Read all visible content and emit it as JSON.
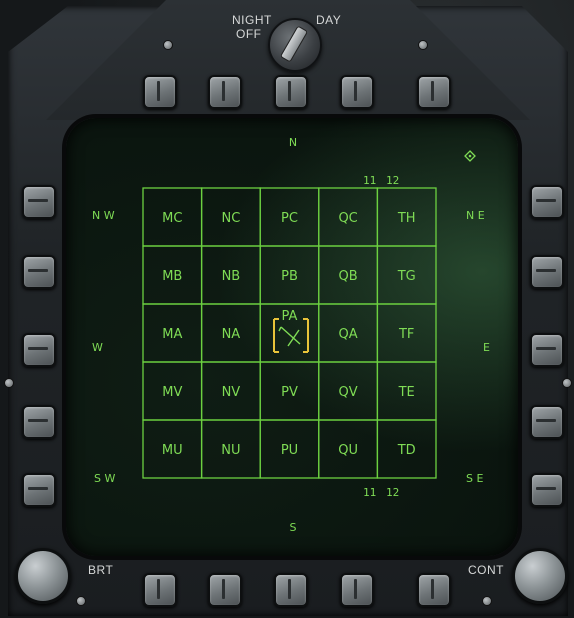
{
  "knob_labels": {
    "left": "NIGHT",
    "left2": "OFF",
    "right": "DAY"
  },
  "display": {
    "compass": {
      "n": "N",
      "s": "S",
      "w": "W",
      "e": "E",
      "nw": "N W",
      "ne": "N E",
      "sw": "S W",
      "se": "S E"
    },
    "col_numbers_top": [
      "11",
      "12"
    ],
    "col_numbers_bottom": [
      "11",
      "12"
    ],
    "grid_cells": [
      [
        "MC",
        "NC",
        "PC",
        "QC",
        "TH"
      ],
      [
        "MB",
        "NB",
        "PB",
        "QB",
        "TG"
      ],
      [
        "MA",
        "NA",
        "PA",
        "QA",
        "TF"
      ],
      [
        "MV",
        "NV",
        "PV",
        "QV",
        "TE"
      ],
      [
        "MU",
        "NU",
        "PU",
        "QU",
        "TD"
      ]
    ],
    "diamond_icon": "diamond-icon",
    "aircraft_icon": "ownship-icon"
  },
  "bottom_labels": {
    "brt": "BRT",
    "cont": "CONT"
  },
  "colors": {
    "hud_green": "#7fdc55",
    "cursor_yellow": "#e8c33a",
    "bezel": "#24282b"
  }
}
